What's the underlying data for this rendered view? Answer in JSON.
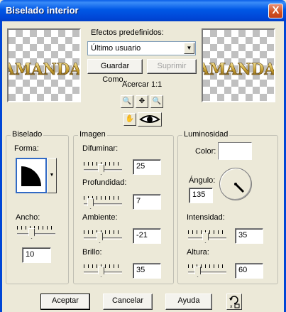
{
  "window": {
    "title": "Biselado interior",
    "close_glyph": "X"
  },
  "preview": {
    "watermark_text": "AMANDA"
  },
  "presets": {
    "label": "Efectos predefinidos:",
    "selected": "Último usuario",
    "save_label": "Guardar Como..",
    "delete_label": "Suprimir"
  },
  "zoom": {
    "label": "Acercar 1:1"
  },
  "bevel": {
    "title": "Biselado",
    "shape_label": "Forma:",
    "width_label": "Ancho:",
    "width_value": "10",
    "width_level": 0.35
  },
  "image": {
    "title": "Imagen",
    "blur_label": "Difuminar:",
    "blur_value": "25",
    "blur_level": 0.45,
    "depth_label": "Profundidad:",
    "depth_value": "7",
    "depth_level": 0.1,
    "ambient_label": "Ambiente:",
    "ambient_value": "-21",
    "ambient_level": 0.4,
    "shine_label": "Brillo:",
    "shine_value": "35",
    "shine_level": 0.45
  },
  "lighting": {
    "title": "Luminosidad",
    "color_label": "Color:",
    "color_value": "#ffffff",
    "angle_label": "Ángulo:",
    "angle_value": "135",
    "intensity_label": "Intensidad:",
    "intensity_value": "35",
    "intensity_level": 0.45,
    "height_label": "Altura:",
    "height_value": "60",
    "height_level": 0.2
  },
  "footer": {
    "ok_label": "Aceptar",
    "cancel_label": "Cancelar",
    "help_label": "Ayuda"
  }
}
